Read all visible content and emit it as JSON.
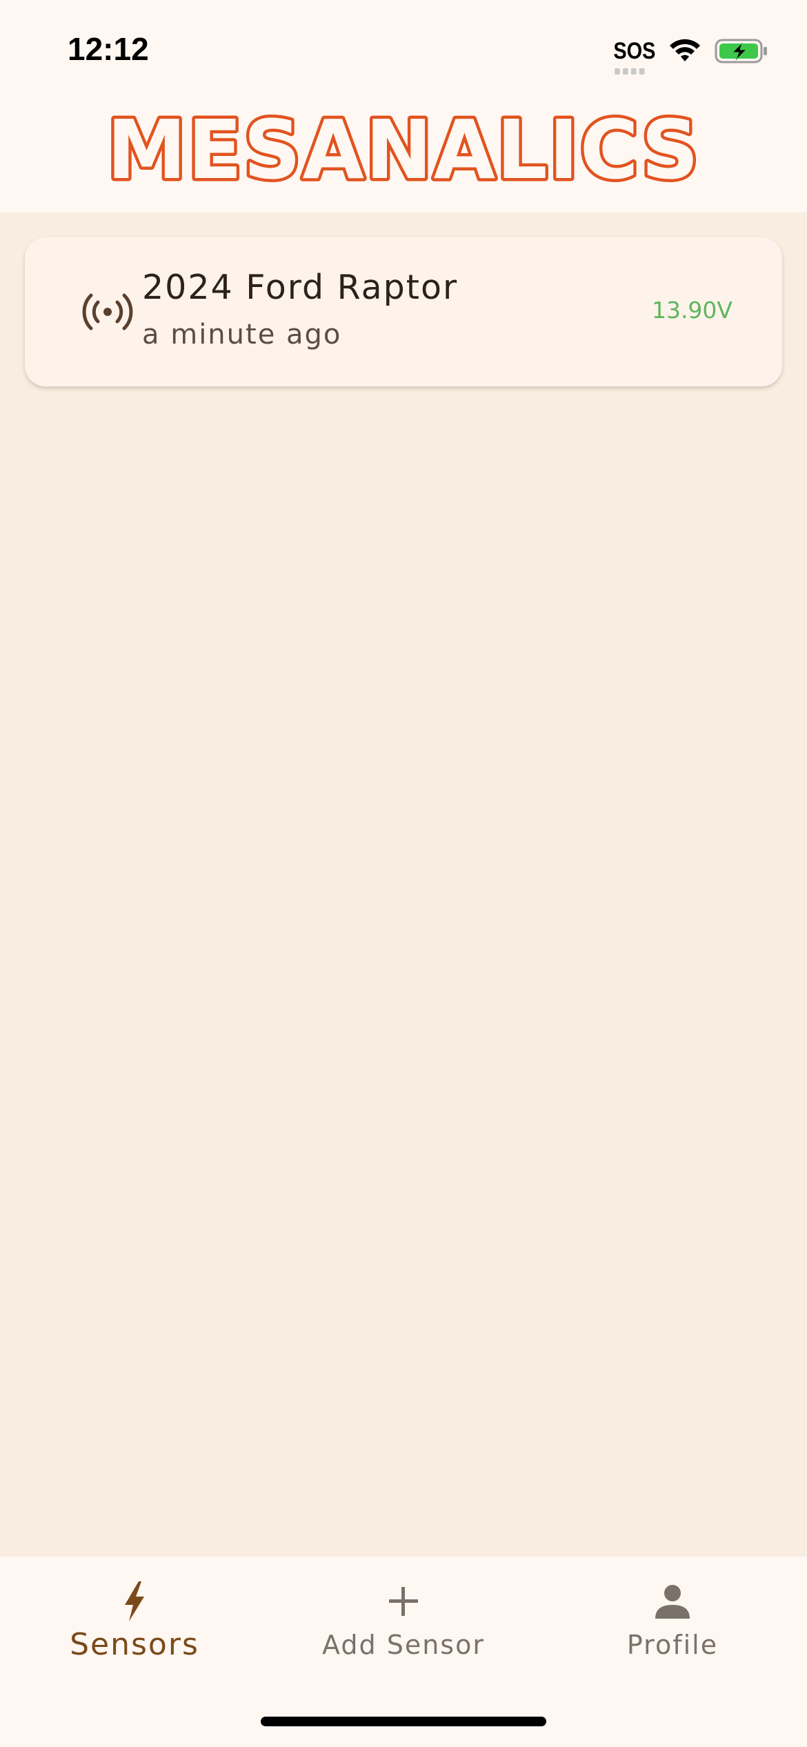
{
  "status_bar": {
    "time": "12:12",
    "sos": "SOS",
    "icons": [
      "wifi-icon",
      "battery-charging-icon"
    ],
    "battery_color": "#3ec84a"
  },
  "header": {
    "logo_text": "MESANALICS",
    "logo_color": "#e2531f"
  },
  "sensors": [
    {
      "name": "2024 Ford Raptor",
      "last_seen": "a minute ago",
      "voltage": "13.90V",
      "voltage_color": "#5fb55d",
      "icon": "broadcast-icon"
    }
  ],
  "nav": {
    "items": [
      {
        "label": "Sensors",
        "icon": "bolt-icon",
        "active": true
      },
      {
        "label": "Add Sensor",
        "icon": "plus-icon",
        "active": false
      },
      {
        "label": "Profile",
        "icon": "person-icon",
        "active": false
      }
    ],
    "active_color": "#7a4a1a",
    "inactive_color": "#7a716b"
  },
  "colors": {
    "background": "#f8ede0",
    "header_background": "#fef7f2",
    "card_background": "#fdf3ea"
  }
}
